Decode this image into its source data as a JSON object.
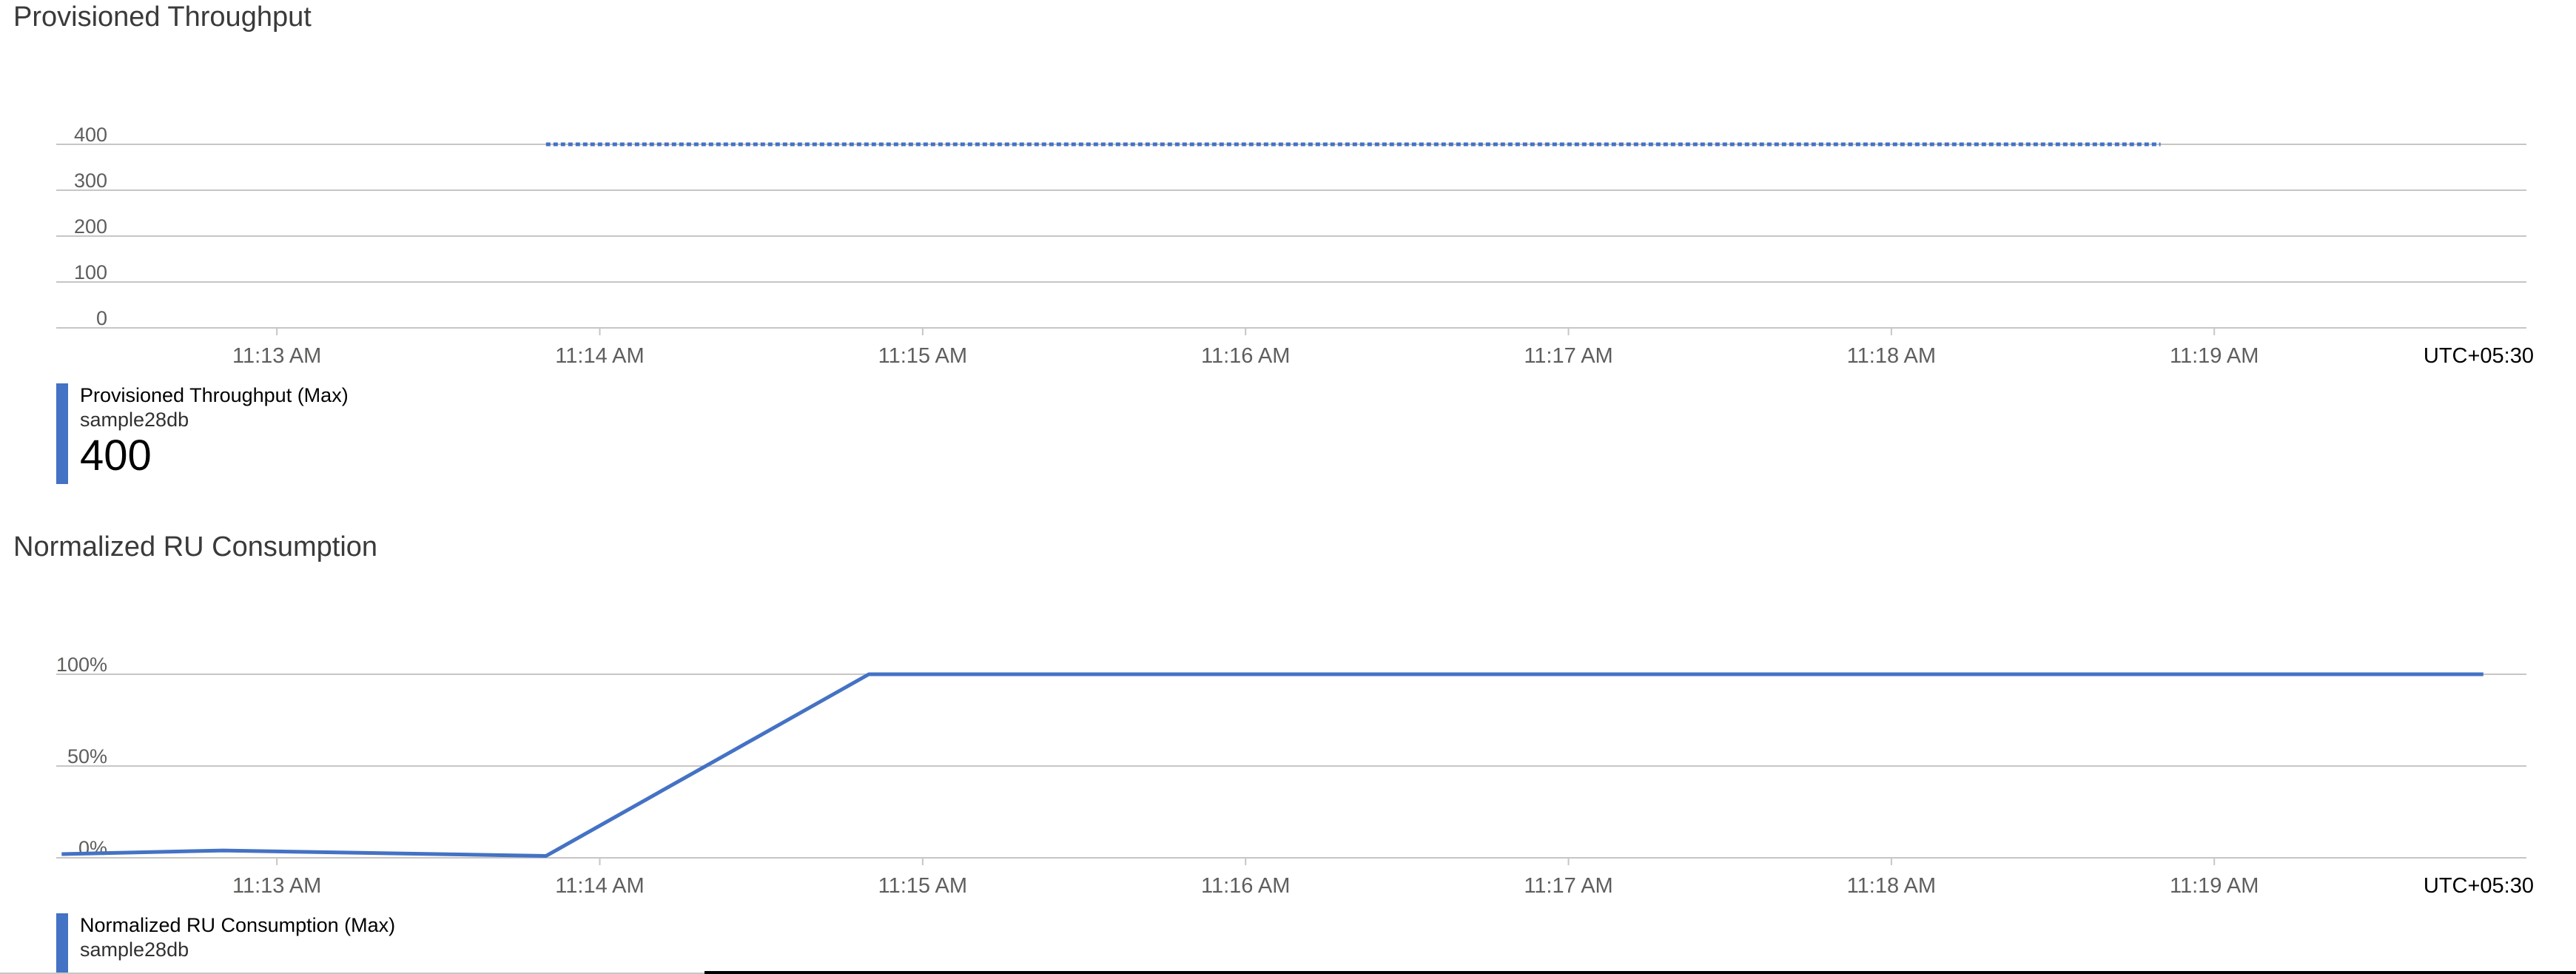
{
  "colors": {
    "series": "#4472c4",
    "grid": "#c8c6c4",
    "axis_text": "#605e5c"
  },
  "chart_data": [
    {
      "type": "line",
      "title": "Provisioned Throughput",
      "timezone_label": "UTC+05:30",
      "x_ticks": [
        "11:13 AM",
        "11:14 AM",
        "11:15 AM",
        "11:16 AM",
        "11:17 AM",
        "11:18 AM",
        "11:19 AM"
      ],
      "x_range": [
        "11:12:19",
        "11:19:58"
      ],
      "y_ticks": [
        "0",
        "100",
        "200",
        "300",
        "400"
      ],
      "ylim": [
        0,
        400
      ],
      "line_style": "dotted",
      "series": [
        {
          "name": "Provisioned Throughput (Max)",
          "x": [
            "11:13:50",
            "11:18:50"
          ],
          "values": [
            400,
            400
          ]
        }
      ],
      "legend": {
        "metric": "Provisioned Throughput (Max)",
        "resource": "sample28db",
        "value": "400"
      }
    },
    {
      "type": "line",
      "title": "Normalized RU Consumption",
      "timezone_label": "UTC+05:30",
      "x_ticks": [
        "11:13 AM",
        "11:14 AM",
        "11:15 AM",
        "11:16 AM",
        "11:17 AM",
        "11:18 AM",
        "11:19 AM"
      ],
      "x_range": [
        "11:12:19",
        "11:19:58"
      ],
      "y_ticks": [
        "0%",
        "50%",
        "100%"
      ],
      "ylim": [
        0,
        100
      ],
      "line_style": "solid",
      "series": [
        {
          "name": "Normalized RU Consumption (Max)",
          "x": [
            "11:12:20",
            "11:12:50",
            "11:13:50",
            "11:14:50",
            "11:15:50",
            "11:16:50",
            "11:17:50",
            "11:18:50",
            "11:19:50"
          ],
          "values": [
            2,
            4,
            1,
            100,
            100,
            100,
            100,
            100,
            100
          ]
        }
      ],
      "legend": {
        "metric": "Normalized RU Consumption (Max)",
        "resource": "sample28db"
      }
    }
  ]
}
